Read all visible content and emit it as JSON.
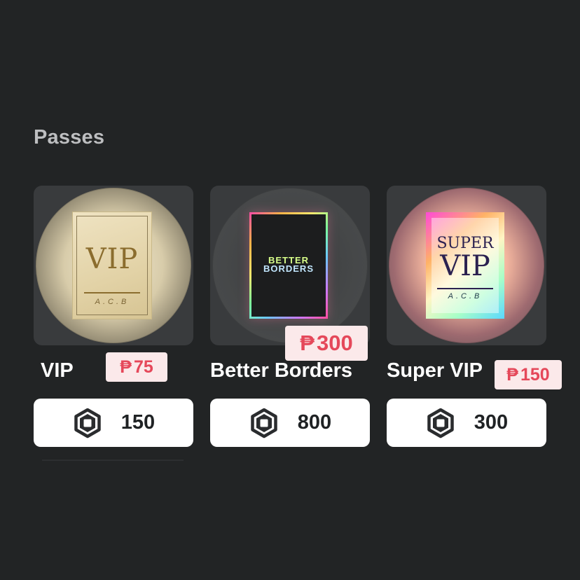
{
  "section": {
    "title": "Passes"
  },
  "currency": {
    "peso_symbol": "₱",
    "robux_icon": "robux-hexagon-icon"
  },
  "colors": {
    "background": "#222425",
    "card_bg": "#393b3d",
    "price_badge_bg": "#fbe9ea",
    "price_badge_text": "#e5485a",
    "buy_button_bg": "#ffffff"
  },
  "passes": [
    {
      "name": "VIP",
      "peso_price": "75",
      "robux_price": "150",
      "artwork": {
        "title": "VIP",
        "subtitle": "A.C.B"
      }
    },
    {
      "name": "Better Borders",
      "peso_price": "300",
      "robux_price": "800",
      "artwork": {
        "line1": "BETTER",
        "line2": "BORDERS"
      }
    },
    {
      "name": "Super VIP",
      "peso_price": "150",
      "robux_price": "300",
      "artwork": {
        "title_top": "SUPER",
        "title": "VIP",
        "subtitle": "A.C.B"
      }
    }
  ]
}
